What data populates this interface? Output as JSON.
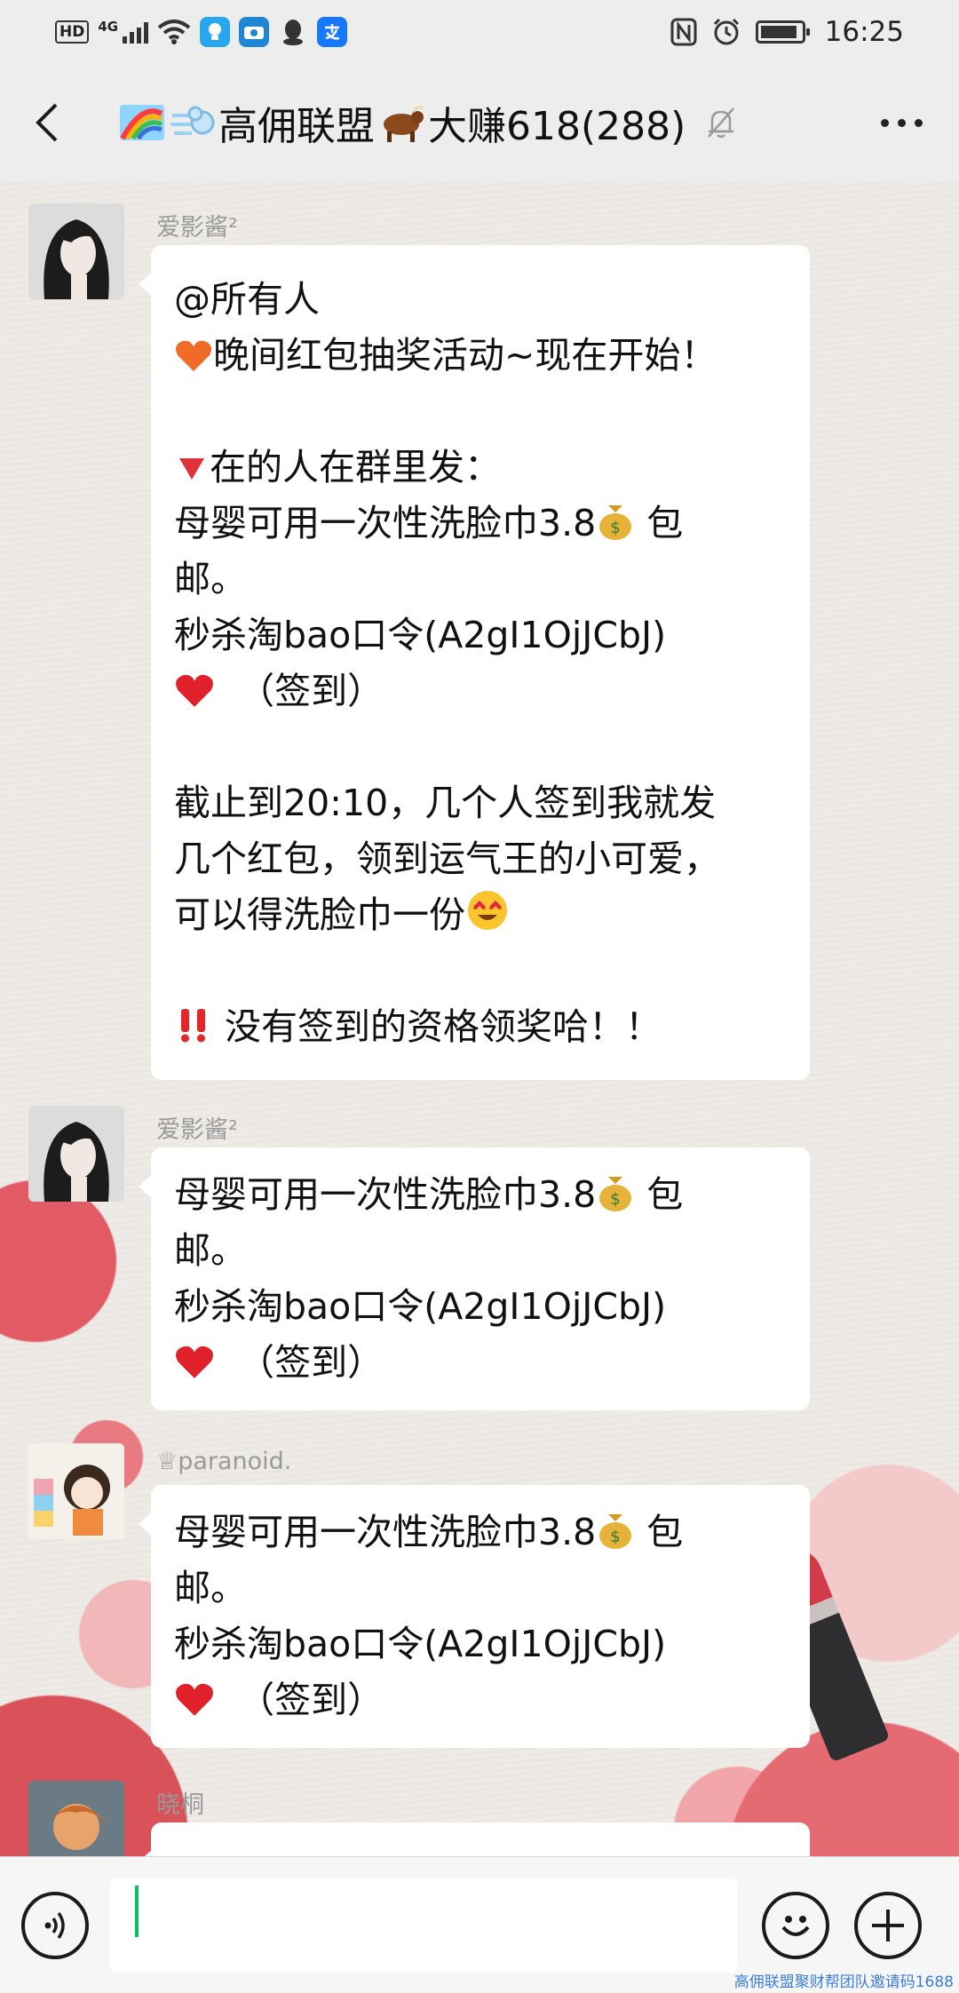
{
  "status_bar": {
    "hd": "HD",
    "network": "4G",
    "time": "16:25"
  },
  "header": {
    "title": "高佣联盟",
    "title_suffix": "大赚618(288)"
  },
  "messages": [
    {
      "sender": "爱影酱²",
      "lines": [
        "@所有人",
        "晚间红包抽奖活动~现在开始！",
        "",
        "在的人在群里发：",
        "母婴可用一次性洗脸巾3.8",
        "邮。",
        "秒杀淘bao口令(A2gI1OjJCbJ)",
        "（签到）",
        "",
        "截止到20:10，几个人签到我就发",
        "几个红包，领到运气王的小可爱，",
        "可以得洗脸巾一份",
        "",
        "没有签到的资格领奖哈！！"
      ],
      "baoyou": "包"
    },
    {
      "sender": "爱影酱²",
      "lines": [
        "母婴可用一次性洗脸巾3.8",
        "邮。",
        "秒杀淘bao口令(A2gI1OjJCbJ)",
        "（签到）"
      ],
      "baoyou": "包"
    },
    {
      "sender": "♕paranoid.",
      "lines": [
        "母婴可用一次性洗脸巾3.8",
        "邮。",
        "秒杀淘bao口令(A2gI1OjJCbJ)",
        "（签到）"
      ],
      "baoyou": "包"
    },
    {
      "sender": "晓桐"
    }
  ],
  "input_bar": {
    "value": ""
  },
  "watermark": "高佣联盟聚财帮团队邀请码1688",
  "colors": {
    "accent": "#07c160",
    "bubble": "#ffffff",
    "header_bg": "#ededed"
  },
  "icons": [
    "back-arrow-icon",
    "rainbow-icon",
    "dash-icon",
    "ox-icon",
    "mute-bell-icon",
    "more-icon",
    "voice-icon",
    "emoji-icon",
    "plus-icon",
    "heart-icon",
    "money-bag-icon",
    "red-triangle-icon",
    "double-exclamation-icon",
    "heart-eyes-icon"
  ]
}
